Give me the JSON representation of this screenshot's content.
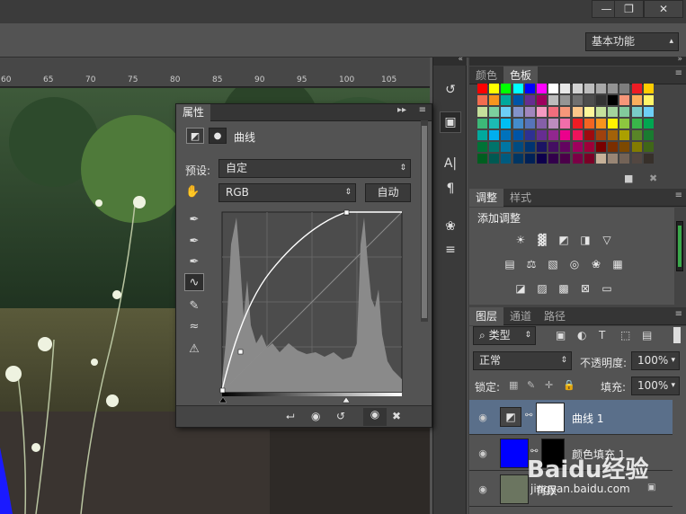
{
  "workspace": {
    "label": "基本功能"
  },
  "ruler": {
    "ticks": [
      "60",
      "65",
      "70",
      "75",
      "80",
      "85",
      "90",
      "95",
      "100",
      "105"
    ]
  },
  "color_panel": {
    "tabs": [
      "颜色",
      "色板"
    ],
    "swatch_rows": [
      [
        "#ff0000",
        "#ffff00",
        "#00ff00",
        "#00ffff",
        "#0000ff",
        "#ff00ff",
        "#ffffff",
        "#e8e8e8",
        "#d2d2d2",
        "#bdbdbd",
        "#a8a8a8",
        "#939393",
        "#7e7e7e",
        "#ed1c24",
        "#ffcc00"
      ],
      [
        "#f26c4f",
        "#f7941d",
        "#00a99d",
        "#0054a6",
        "#662d91",
        "#9e005d",
        "#bcbcbc",
        "#959595",
        "#707070",
        "#4d4d4d",
        "#333333",
        "#000000",
        "#f69679",
        "#fbaf5d",
        "#fff568"
      ],
      [
        "#c4df9b",
        "#7ccf9e",
        "#6dcff6",
        "#8393ca",
        "#a186be",
        "#f49ac2",
        "#f26d7d",
        "#f7977a",
        "#fdc68a",
        "#fff79a",
        "#c6e29c",
        "#a3d39c",
        "#82ca9c",
        "#7accc8",
        "#6ecff6"
      ],
      [
        "#3cb878",
        "#1cbbb4",
        "#00bff3",
        "#448ccb",
        "#5674b9",
        "#855fa8",
        "#bd8cbf",
        "#f06eaa",
        "#ed1c24",
        "#f26522",
        "#f7941d",
        "#fff200",
        "#8dc63f",
        "#39b54a",
        "#00a651"
      ],
      [
        "#00a99d",
        "#00aeef",
        "#0072bc",
        "#0054a6",
        "#2e3192",
        "#662d91",
        "#92278f",
        "#ec008c",
        "#ed145b",
        "#9e0b0f",
        "#a0410d",
        "#a36209",
        "#aba000",
        "#598527",
        "#1a7b30"
      ],
      [
        "#007236",
        "#00746b",
        "#0076a3",
        "#004b80",
        "#003471",
        "#1b1464",
        "#440e62",
        "#630460",
        "#9e005d",
        "#9e0039",
        "#790000",
        "#7b2e00",
        "#7d4900",
        "#827b00",
        "#406618"
      ],
      [
        "#005e20",
        "#005952",
        "#005b7f",
        "#003663",
        "#002157",
        "#0d004c",
        "#32004b",
        "#4b0049",
        "#7b0046",
        "#7a0026",
        "#c7b299",
        "#998675",
        "#736357",
        "#534741",
        "#37302a"
      ]
    ]
  },
  "adjust_panel": {
    "tabs": [
      "调整",
      "样式"
    ],
    "title": "添加调整"
  },
  "layers_panel": {
    "tabs": [
      "图层",
      "通道",
      "路径"
    ],
    "filter_label": "类型",
    "blend_mode": "正常",
    "opacity_label": "不透明度:",
    "opacity_value": "100%",
    "lock_label": "锁定:",
    "fill_label": "填充:",
    "fill_value": "100%",
    "layers": [
      {
        "name": "曲线 1",
        "selected": true
      },
      {
        "name": "颜色填充 1",
        "selected": false
      },
      {
        "name": "背景",
        "selected": false
      }
    ]
  },
  "properties_panel": {
    "tab": "属性",
    "title": "曲线",
    "preset_label": "预设:",
    "preset_value": "自定",
    "channel_value": "RGB",
    "auto_label": "自动"
  },
  "watermark": {
    "brand": "Baidu经验",
    "url": "jingyan.baidu.com"
  },
  "colors": {
    "accent_layer": "#0000ff",
    "panel_bg": "#535353",
    "dark_bg": "#3a3a3a"
  }
}
